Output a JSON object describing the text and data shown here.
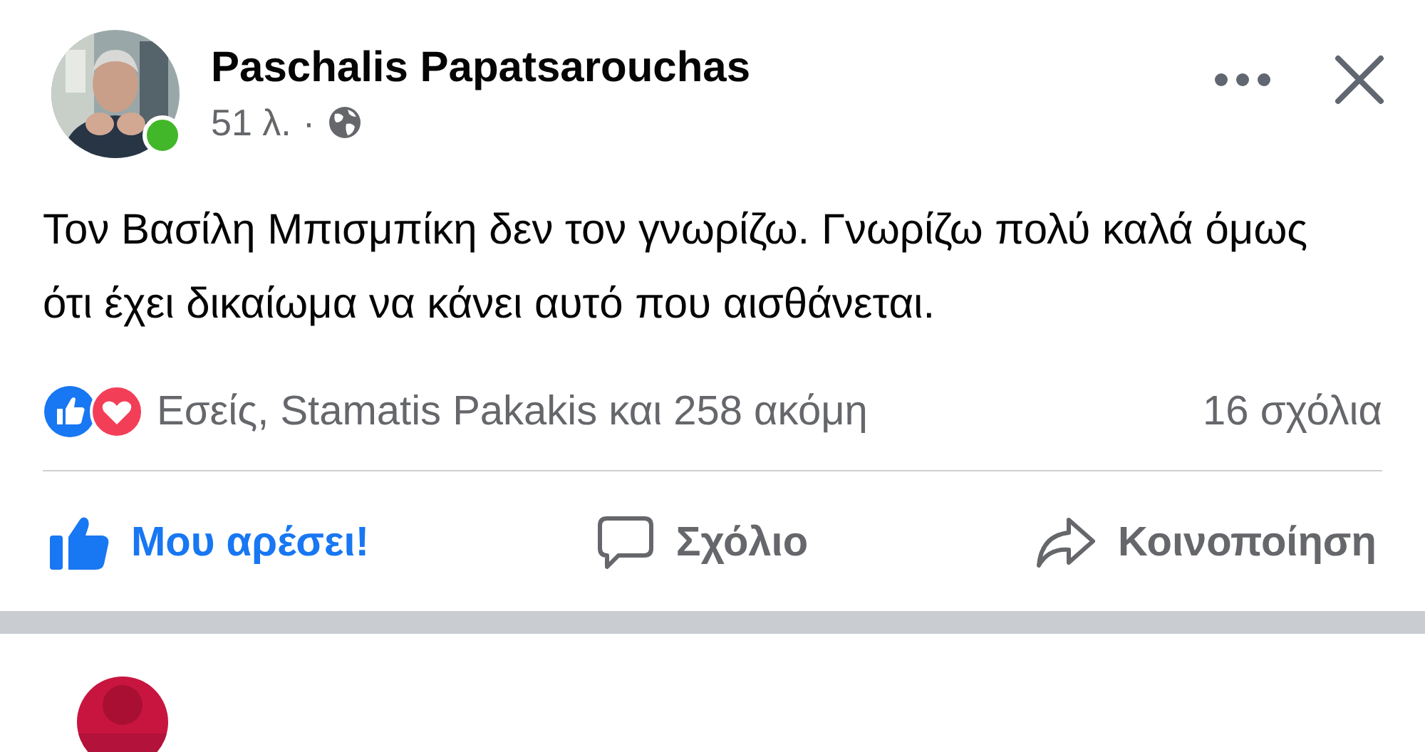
{
  "post": {
    "author": "Paschalis Papatsarouchas",
    "online": true,
    "time": "51 λ.",
    "separator": "·",
    "text": "Τον Βασίλη Μπισμπίκη δεν τον γνωρίζω. Γνωρίζω πολύ καλά όμως ότι έχει δικαίωμα να κάνει αυτό που αισθάνεται.",
    "reactions": {
      "summary": "Εσείς, Stamatis Pakakis και 258 ακόμη",
      "comments": "16 σχόλια"
    },
    "actions": [
      {
        "kind": "like",
        "label": "Μου αρέσει!",
        "selected": true
      },
      {
        "kind": "comment",
        "label": "Σχόλιο",
        "selected": false
      },
      {
        "kind": "share",
        "label": "Κοινοποίηση",
        "selected": false
      }
    ]
  }
}
